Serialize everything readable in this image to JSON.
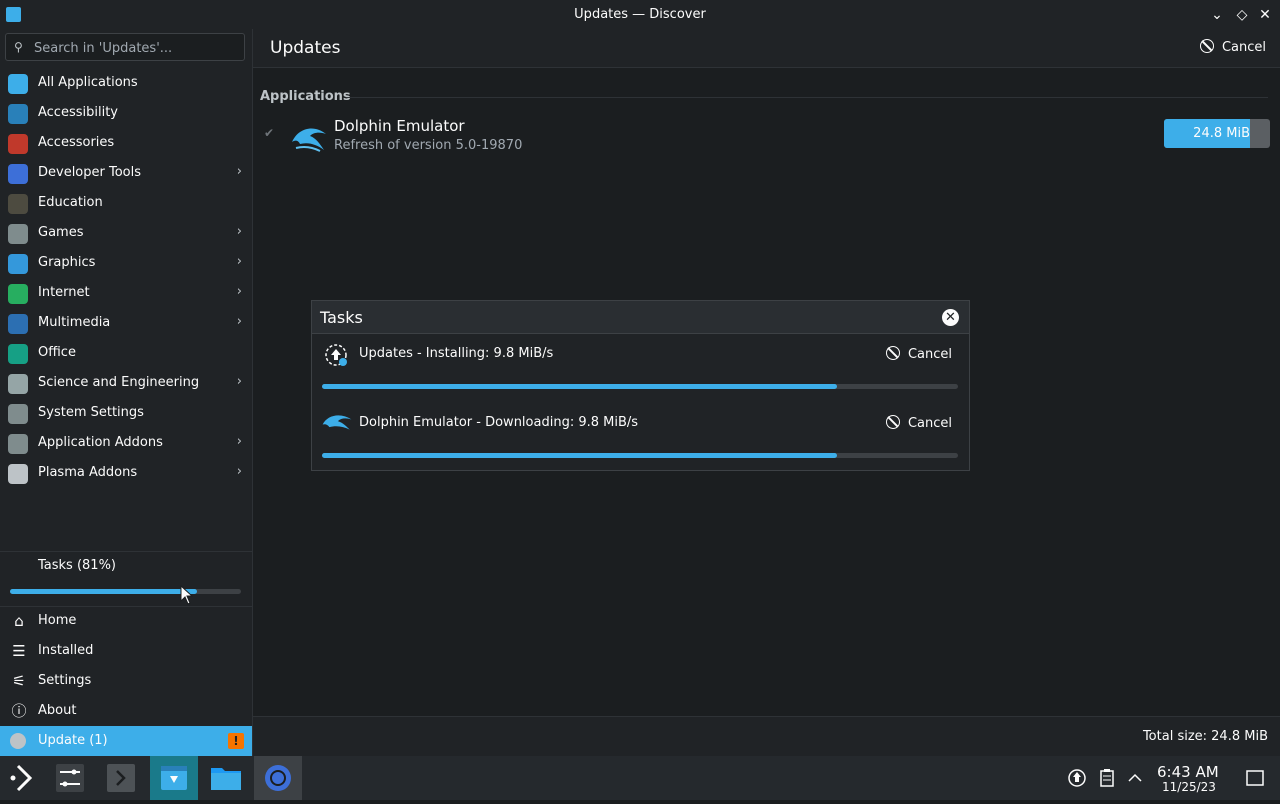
{
  "window": {
    "title": "Updates — Discover",
    "minimize_glyph": "⌄",
    "maximize_glyph": "◇",
    "close_glyph": "✕"
  },
  "sidebar": {
    "search_placeholder": "Search in 'Updates'...",
    "categories": [
      {
        "label": "All Applications",
        "icon": "grid-icon",
        "color": "#3daee9",
        "submenu": false
      },
      {
        "label": "Accessibility",
        "icon": "accessibility-icon",
        "color": "#2980b9",
        "submenu": false
      },
      {
        "label": "Accessories",
        "icon": "toolbox-icon",
        "color": "#c0392b",
        "submenu": false
      },
      {
        "label": "Developer Tools",
        "icon": "developer-icon",
        "color": "#3d6fd8",
        "submenu": true
      },
      {
        "label": "Education",
        "icon": "chalkboard-icon",
        "color": "#4d4b40",
        "submenu": false
      },
      {
        "label": "Games",
        "icon": "gamepad-icon",
        "color": "#7f8c8d",
        "submenu": true
      },
      {
        "label": "Graphics",
        "icon": "graphics-icon",
        "color": "#3498db",
        "submenu": true
      },
      {
        "label": "Internet",
        "icon": "globe-icon",
        "color": "#27ae60",
        "submenu": true
      },
      {
        "label": "Multimedia",
        "icon": "monitor-icon",
        "color": "#2c6fb2",
        "submenu": true
      },
      {
        "label": "Office",
        "icon": "office-icon",
        "color": "#16a085",
        "submenu": false
      },
      {
        "label": "Science and Engineering",
        "icon": "science-icon",
        "color": "#95a5a6",
        "submenu": true
      },
      {
        "label": "System Settings",
        "icon": "settings-icon",
        "color": "#7f8c8d",
        "submenu": false
      },
      {
        "label": "Application Addons",
        "icon": "addons-icon",
        "color": "#7f8c8d",
        "submenu": true
      },
      {
        "label": "Plasma Addons",
        "icon": "plasma-icon",
        "color": "#bdc3c7",
        "submenu": true
      }
    ],
    "tasks_label": "Tasks (81%)",
    "tasks_progress": 0.81,
    "nav": [
      {
        "label": "Home",
        "icon": "home-icon",
        "glyph": "⌂"
      },
      {
        "label": "Installed",
        "icon": "installed-icon",
        "glyph": "☰"
      },
      {
        "label": "Settings",
        "icon": "settings-sliders-icon",
        "glyph": "⚟"
      },
      {
        "label": "About",
        "icon": "info-icon",
        "glyph": "ⓘ"
      }
    ],
    "update_label": "Update (1)",
    "update_badge": "!"
  },
  "header": {
    "title": "Updates",
    "cancel_label": "Cancel"
  },
  "updates": {
    "section_title": "Applications",
    "items": [
      {
        "name": "Dolphin Emulator",
        "detail": "Refresh of version 5.0-19870",
        "size": "24.8 MiB",
        "progress": 0.81
      }
    ]
  },
  "tasks_dialog": {
    "title": "Tasks",
    "close_glyph": "✕",
    "tasks": [
      {
        "label": "Updates - Installing: 9.8 MiB/s",
        "cancel_label": "Cancel",
        "progress": 0.81,
        "icon": "updates-icon"
      },
      {
        "label": "Dolphin Emulator - Downloading: 9.8 MiB/s",
        "cancel_label": "Cancel",
        "progress": 0.81,
        "icon": "dolphin-icon"
      }
    ]
  },
  "footer": {
    "total_size": "Total size: 24.8 MiB"
  },
  "taskbar": {
    "time": "6:43 AM",
    "date": "11/25/23"
  },
  "colors": {
    "accent": "#3daee9",
    "background": "#1b1e20",
    "panel": "#202326",
    "warning": "#f67400"
  }
}
